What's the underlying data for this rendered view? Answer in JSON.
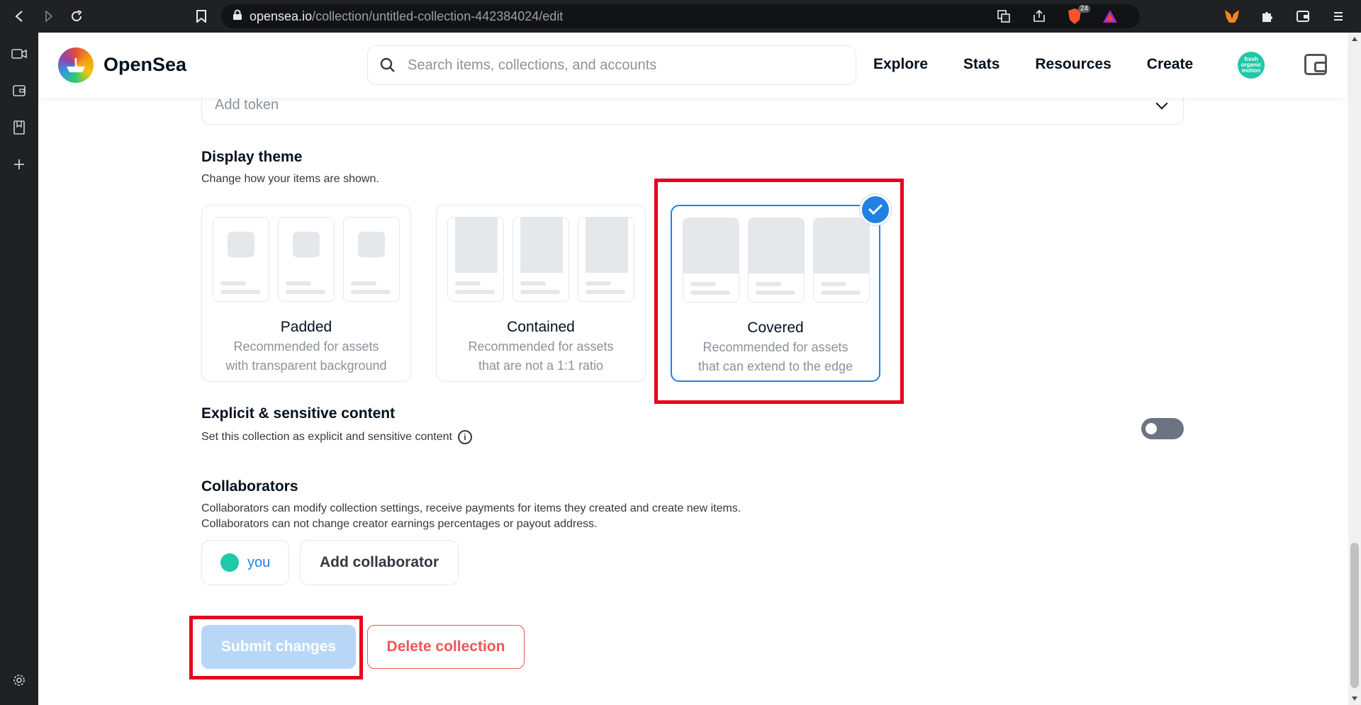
{
  "browser": {
    "url_domain": "opensea.io",
    "url_path": "/collection/untitled-collection-442384024/edit",
    "brave_badge": "24"
  },
  "header": {
    "brand": "OpenSea",
    "search_placeholder": "Search items, collections, and accounts",
    "nav": [
      "Explore",
      "Stats",
      "Resources",
      "Create"
    ],
    "avatar_text": "fresh organic motion"
  },
  "token": {
    "placeholder": "Add token"
  },
  "display_theme": {
    "title": "Display theme",
    "subtitle": "Change how your items are shown.",
    "options": [
      {
        "title": "Padded",
        "desc1": "Recommended for assets",
        "desc2": "with transparent background"
      },
      {
        "title": "Contained",
        "desc1": "Recommended for assets",
        "desc2": "that are not a 1:1 ratio"
      },
      {
        "title": "Covered",
        "desc1": "Recommended for assets",
        "desc2": "that can extend to the edge"
      }
    ],
    "selected": "Covered"
  },
  "explicit": {
    "title": "Explicit & sensitive content",
    "subtitle": "Set this collection as explicit and sensitive content",
    "enabled": false
  },
  "collaborators": {
    "title": "Collaborators",
    "line1": "Collaborators can modify collection settings, receive payments for items they created and create new items.",
    "line2": "Collaborators can not change creator earnings percentages or payout address.",
    "you_label": "you",
    "add_label": "Add collaborator"
  },
  "actions": {
    "submit": "Submit changes",
    "delete": "Delete collection"
  },
  "colors": {
    "accent": "#2081e2",
    "highlight": "#e8001c",
    "danger": "#eb5757"
  }
}
